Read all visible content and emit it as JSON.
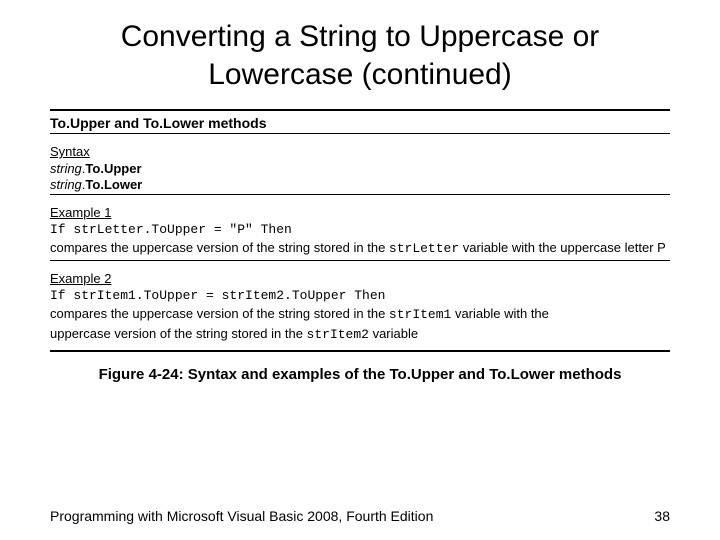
{
  "title_line1": "Converting a String to Uppercase or",
  "title_line2": "Lowercase (continued)",
  "section_head": "To.Upper and To.Lower methods",
  "syntax": {
    "label": "Syntax",
    "line1": {
      "obj": "string",
      "sep": ".",
      "method": "To.Upper"
    },
    "line2": {
      "obj": "string",
      "sep": ".",
      "method": "To.Lower"
    }
  },
  "ex1": {
    "label": "Example 1",
    "code": "If strLetter.ToUpper = \"P\" Then",
    "desc_pre": "compares the uppercase version of the string stored in the ",
    "desc_var": "strLetter",
    "desc_post": " variable with the uppercase letter P"
  },
  "ex2": {
    "label": "Example 2",
    "code": "If strItem1.ToUpper = strItem2.ToUpper Then",
    "desc1_pre": "compares the uppercase version of the string stored in the ",
    "desc1_var": "strItem1",
    "desc1_post": " variable with the",
    "desc2_pre": "uppercase version of the string stored in the ",
    "desc2_var": "strItem2",
    "desc2_post": " variable"
  },
  "caption": "Figure 4-24: Syntax and examples of the To.Upper and To.Lower methods",
  "footer_left": "Programming with Microsoft Visual Basic 2008, Fourth Edition",
  "footer_right": "38"
}
